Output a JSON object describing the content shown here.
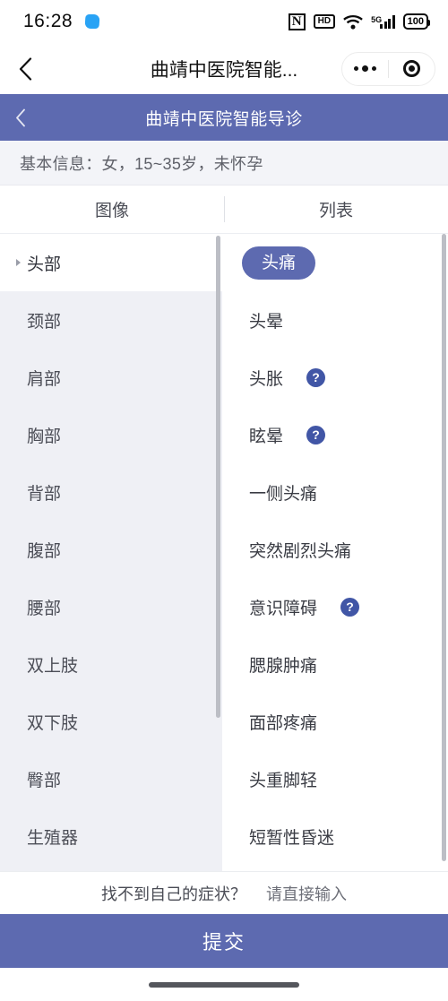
{
  "status_bar": {
    "time": "16:28",
    "app_icon": "app-badge-icon",
    "icons": [
      "nfc-icon",
      "hd-icon",
      "wifi-icon",
      "signal-5g-icon",
      "battery-icon"
    ],
    "nfc_label": "N",
    "hd_label": "HD",
    "network_label": "5G",
    "battery_level": "100"
  },
  "nav_bar": {
    "back_icon": "chevron-left-icon",
    "title": "曲靖中医院智能...",
    "more_icon": "more-dots-icon",
    "close_icon": "target-circle-icon"
  },
  "page_header": {
    "back_icon": "chevron-left-icon",
    "title": "曲靖中医院智能导诊",
    "color": "#5d6ab0"
  },
  "basic_info": {
    "text": "基本信息：女，15~35岁，未怀孕"
  },
  "tabs": [
    {
      "label": "图像",
      "name": "tab-image",
      "active": false
    },
    {
      "label": "列表",
      "name": "tab-list",
      "active": true
    }
  ],
  "body_parts": [
    {
      "label": "头部",
      "active": true
    },
    {
      "label": "颈部",
      "active": false
    },
    {
      "label": "肩部",
      "active": false
    },
    {
      "label": "胸部",
      "active": false
    },
    {
      "label": "背部",
      "active": false
    },
    {
      "label": "腹部",
      "active": false
    },
    {
      "label": "腰部",
      "active": false
    },
    {
      "label": "双上肢",
      "active": false
    },
    {
      "label": "双下肢",
      "active": false
    },
    {
      "label": "臀部",
      "active": false
    },
    {
      "label": "生殖器",
      "active": false
    }
  ],
  "symptoms": [
    {
      "label": "头痛",
      "selected": true,
      "help": false
    },
    {
      "label": "头晕",
      "selected": false,
      "help": false
    },
    {
      "label": "头胀",
      "selected": false,
      "help": true
    },
    {
      "label": "眩晕",
      "selected": false,
      "help": true
    },
    {
      "label": "一侧头痛",
      "selected": false,
      "help": false
    },
    {
      "label": "突然剧烈头痛",
      "selected": false,
      "help": false
    },
    {
      "label": "意识障碍",
      "selected": false,
      "help": true
    },
    {
      "label": "腮腺肿痛",
      "selected": false,
      "help": false
    },
    {
      "label": "面部疼痛",
      "selected": false,
      "help": false
    },
    {
      "label": "头重脚轻",
      "selected": false,
      "help": false
    },
    {
      "label": "短暂性昏迷",
      "selected": false,
      "help": false
    }
  ],
  "help_icon_glyph": "?",
  "footer": {
    "note": "找不到自己的症状？",
    "link": "请直接输入"
  },
  "submit": {
    "label": "提交"
  },
  "colors": {
    "brand_purple": "#5d6ab0",
    "help_blue": "#4156a6",
    "sidebar_bg": "#eff0f5",
    "info_bg": "#f3f4f8"
  }
}
